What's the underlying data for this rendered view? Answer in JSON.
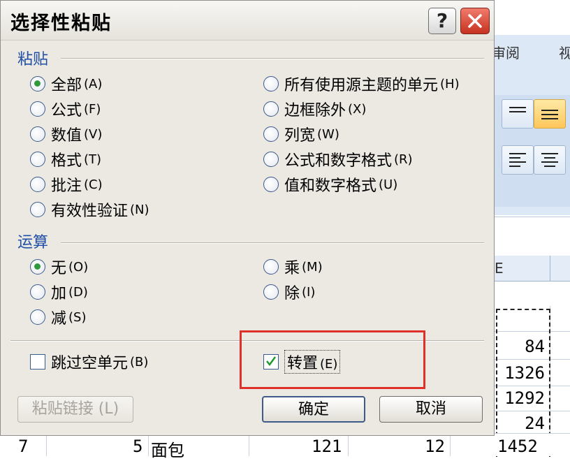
{
  "dialog": {
    "title": "选择性粘贴",
    "help_label": "?",
    "paste_section": {
      "label": "粘贴",
      "left": [
        {
          "text": "全部",
          "key": "(A)",
          "checked": true
        },
        {
          "text": "公式",
          "key": "(F)",
          "checked": false
        },
        {
          "text": "数值",
          "key": "(V)",
          "checked": false
        },
        {
          "text": "格式",
          "key": "(T)",
          "checked": false
        },
        {
          "text": "批注",
          "key": "(C)",
          "checked": false
        },
        {
          "text": "有效性验证",
          "key": "(N)",
          "checked": false
        }
      ],
      "right": [
        {
          "text": "所有使用源主题的单元",
          "key": "(H)",
          "checked": false
        },
        {
          "text": "边框除外",
          "key": "(X)",
          "checked": false
        },
        {
          "text": "列宽",
          "key": "(W)",
          "checked": false
        },
        {
          "text": "公式和数字格式",
          "key": "(R)",
          "checked": false
        },
        {
          "text": "值和数字格式",
          "key": "(U)",
          "checked": false
        }
      ]
    },
    "operation_section": {
      "label": "运算",
      "left": [
        {
          "text": "无",
          "key": "(O)",
          "checked": true
        },
        {
          "text": "加",
          "key": "(D)",
          "checked": false
        },
        {
          "text": "减",
          "key": "(S)",
          "checked": false
        }
      ],
      "right": [
        {
          "text": "乘",
          "key": "(M)",
          "checked": false
        },
        {
          "text": "除",
          "key": "(I)",
          "checked": false
        }
      ]
    },
    "skip_blanks": {
      "text": "跳过空单元",
      "key": "(B)",
      "checked": false
    },
    "transpose": {
      "text": "转置",
      "key": "(E)",
      "checked": true
    },
    "buttons": {
      "paste_link": "粘贴链接 (L)",
      "ok": "确定",
      "cancel": "取消"
    }
  },
  "background": {
    "ribbon_tabs": [
      "审阅",
      "视"
    ],
    "column_header": "E",
    "cells": [
      "84",
      "1326",
      "1292",
      "24"
    ],
    "bottom_row": {
      "row": "7",
      "a": "5",
      "b": "面包",
      "c": "121",
      "d": "12",
      "e": "1452"
    }
  },
  "colors": {
    "highlight_box": "#e0302a",
    "section_label": "#1f4fa6",
    "radio_dot": "#2e9a3c"
  }
}
